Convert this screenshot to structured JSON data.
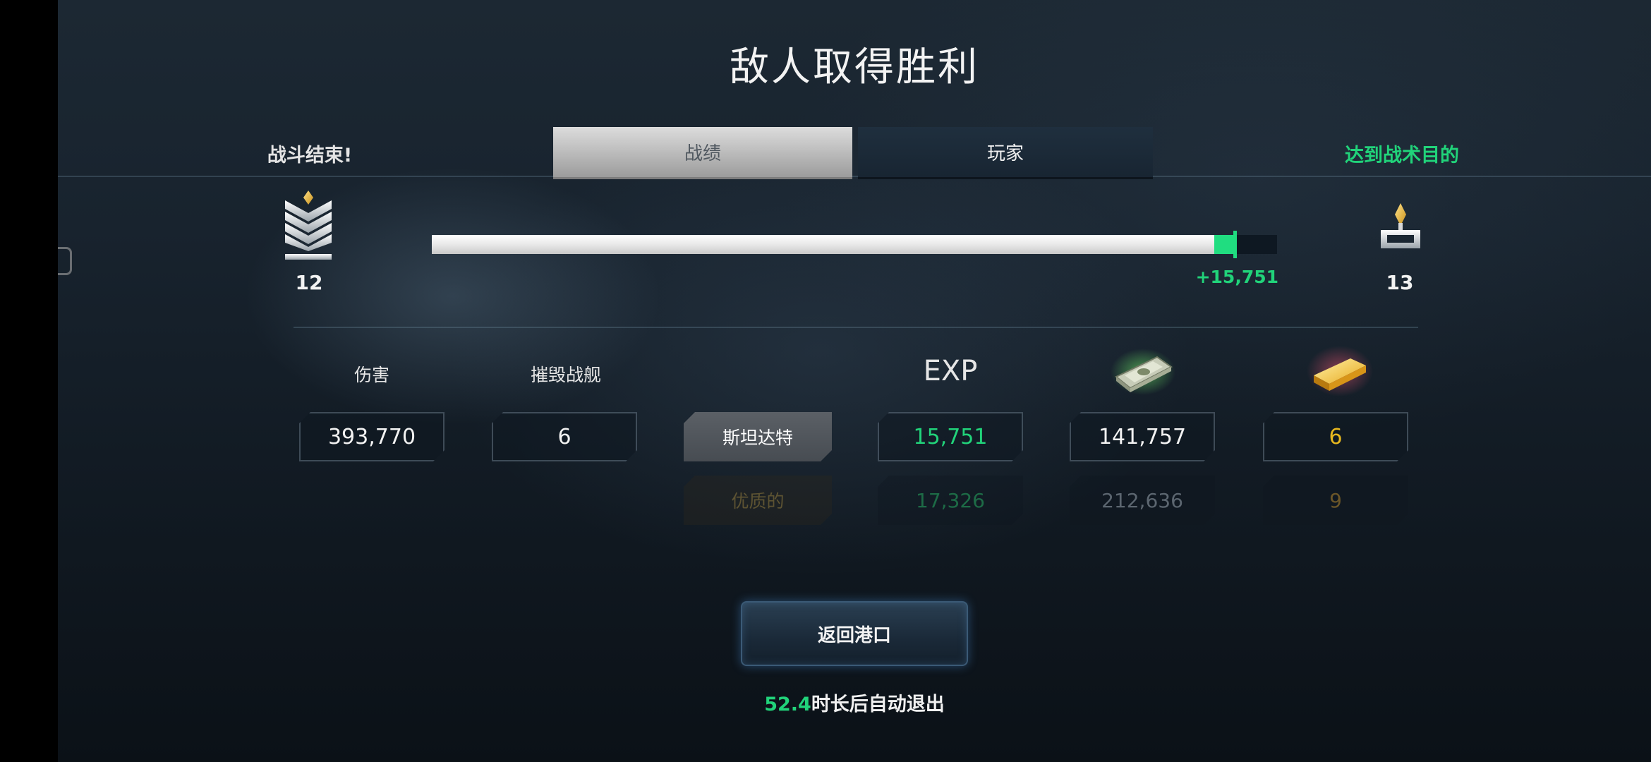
{
  "title": "敌人取得胜利",
  "status_left": "战斗结束!",
  "status_right": "达到战术目的",
  "tabs": [
    {
      "label": "战绩",
      "active": true
    },
    {
      "label": "玩家",
      "active": false
    }
  ],
  "rank": {
    "current": "12",
    "next": "13",
    "progress_fraction": 0.95,
    "gain_fraction": 0.024,
    "gain_label": "+15,751"
  },
  "columns": {
    "damage": "伤害",
    "destroyed": "摧毁战舰",
    "exp": "EXP",
    "money_icon": "money-stack-icon",
    "gold_icon": "gold-bar-icon"
  },
  "left_stats": {
    "damage": "393,770",
    "destroyed": "6"
  },
  "rows": [
    {
      "label": "斯坦达特",
      "exp": "15,751",
      "money": "141,757",
      "gold": "6"
    },
    {
      "label": "优质的",
      "exp": "17,326",
      "money": "212,636",
      "gold": "9"
    }
  ],
  "return_button": "返回港口",
  "auto_exit": {
    "seconds": "52.4",
    "text": "时长后自动退出"
  },
  "colors": {
    "accent_green": "#21d37a",
    "gold": "#e8b81e",
    "premium_text": "#5d5332"
  }
}
